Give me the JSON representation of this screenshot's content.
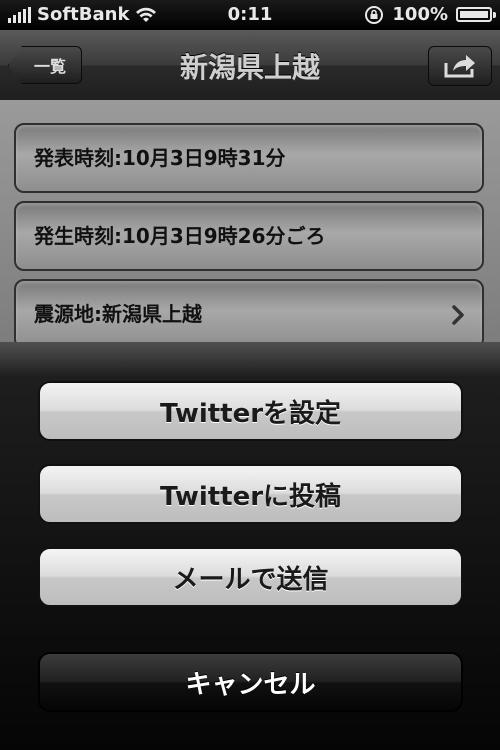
{
  "status_bar": {
    "carrier": "SoftBank",
    "time": "0:11",
    "battery": "100%",
    "battery_level": 1.0
  },
  "nav": {
    "back_label": "一覧",
    "title": "新潟県上越",
    "share_icon": "share-icon"
  },
  "detail": {
    "rows": [
      {
        "label": "発表時刻:10月3日9時31分"
      },
      {
        "label": "発生時刻:10月3日9時26分ごろ"
      },
      {
        "label": "震源地:新潟県上越"
      }
    ]
  },
  "action_sheet": {
    "buttons": [
      {
        "label": "Twitterを設定"
      },
      {
        "label": "Twitterに投稿"
      },
      {
        "label": "メールで送信"
      }
    ],
    "cancel_label": "キャンセル"
  }
}
